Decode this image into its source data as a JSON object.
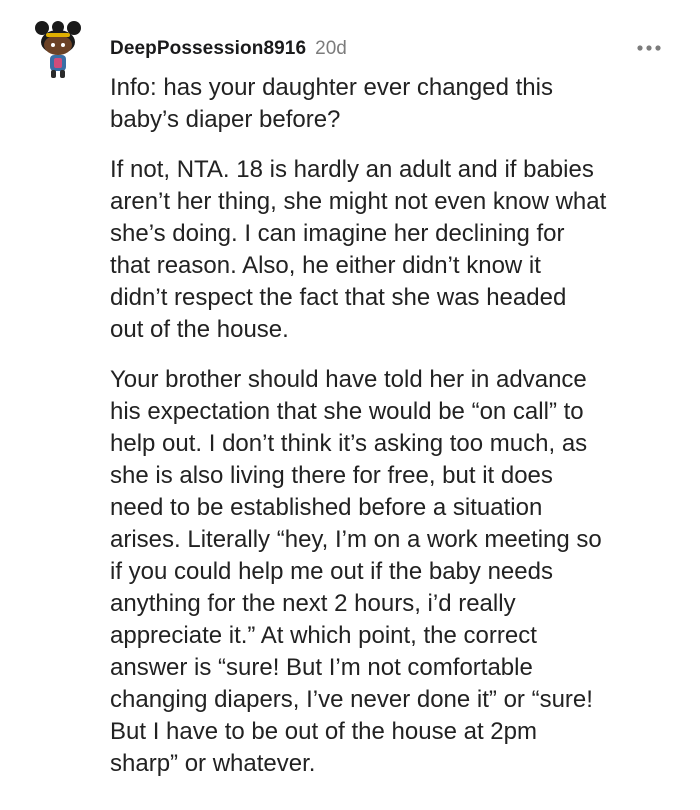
{
  "comment": {
    "username": "DeepPossession8916",
    "timestamp": "20d",
    "more_icon": "more-horizontal-icon",
    "avatar_icon": "snoo-avatar-icon",
    "paragraphs": [
      "Info: has your daughter ever changed this\nbaby’s diaper before?",
      "If not, NTA. 18 is hardly an adult and if babies\naren’t her thing, she might not even know what\nshe’s doing. I can imagine her declining for\nthat reason. Also, he either didn’t know it\ndidn’t respect the fact that she was headed\nout of the house.",
      "Your brother should have told her in advance\nhis expectation that she would be “on call” to\nhelp out. I don’t think it’s asking too much, as\nshe is also living there for free, but it does\nneed to be established before a situation\narises. Literally “hey, I’m on a work meeting so\nif you could help me out if the baby needs\nanything for the next 2 hours, i’d really\nappreciate it.” At which point, the correct\nanswer is “sure! But I’m not comfortable\nchanging diapers, I’ve never done it” or “sure!\nBut I have to be out of the house at 2pm\nsharp” or whatever."
    ]
  },
  "colors": {
    "username": "#1a1a1b",
    "timestamp": "#7c7c7c",
    "body": "#222222",
    "background": "#ffffff"
  }
}
